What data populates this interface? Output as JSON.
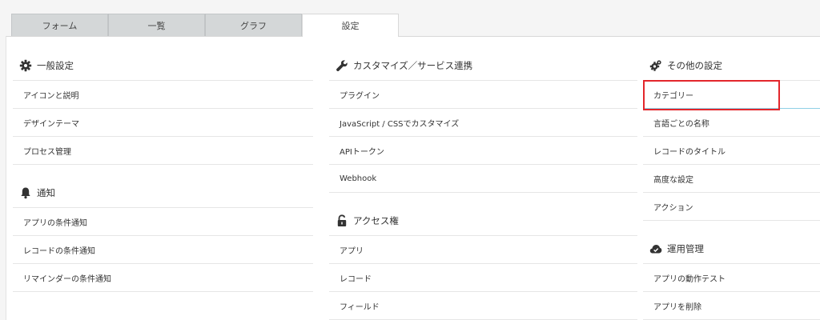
{
  "tabs": [
    {
      "label": "フォーム",
      "active": false
    },
    {
      "label": "一覧",
      "active": false
    },
    {
      "label": "グラフ",
      "active": false
    },
    {
      "label": "設定",
      "active": true
    }
  ],
  "col1": {
    "general": {
      "title": "一般設定",
      "icon": "gear-icon",
      "items": [
        "アイコンと説明",
        "デザインテーマ",
        "プロセス管理"
      ]
    },
    "notify": {
      "title": "通知",
      "icon": "bell-icon",
      "items": [
        "アプリの条件通知",
        "レコードの条件通知",
        "リマインダーの条件通知"
      ]
    }
  },
  "col2": {
    "customize": {
      "title": "カスタマイズ／サービス連携",
      "icon": "wrench-icon",
      "items": [
        "プラグイン",
        "JavaScript / CSSでカスタマイズ",
        "APIトークン",
        "Webhook"
      ]
    },
    "access": {
      "title": "アクセス権",
      "icon": "lock-icon",
      "items": [
        "アプリ",
        "レコード",
        "フィールド"
      ]
    }
  },
  "col3": {
    "other": {
      "title": "その他の設定",
      "icon": "gears-icon",
      "items": [
        "カテゴリー",
        "言語ごとの名称",
        "レコードのタイトル",
        "高度な設定",
        "アクション"
      ]
    },
    "ops": {
      "title": "運用管理",
      "icon": "cloud-icon",
      "items": [
        "アプリの動作テスト",
        "アプリを削除"
      ]
    }
  },
  "colors": {
    "highlight_border": "#e3262b",
    "item_accent": "#8fd0e6"
  }
}
